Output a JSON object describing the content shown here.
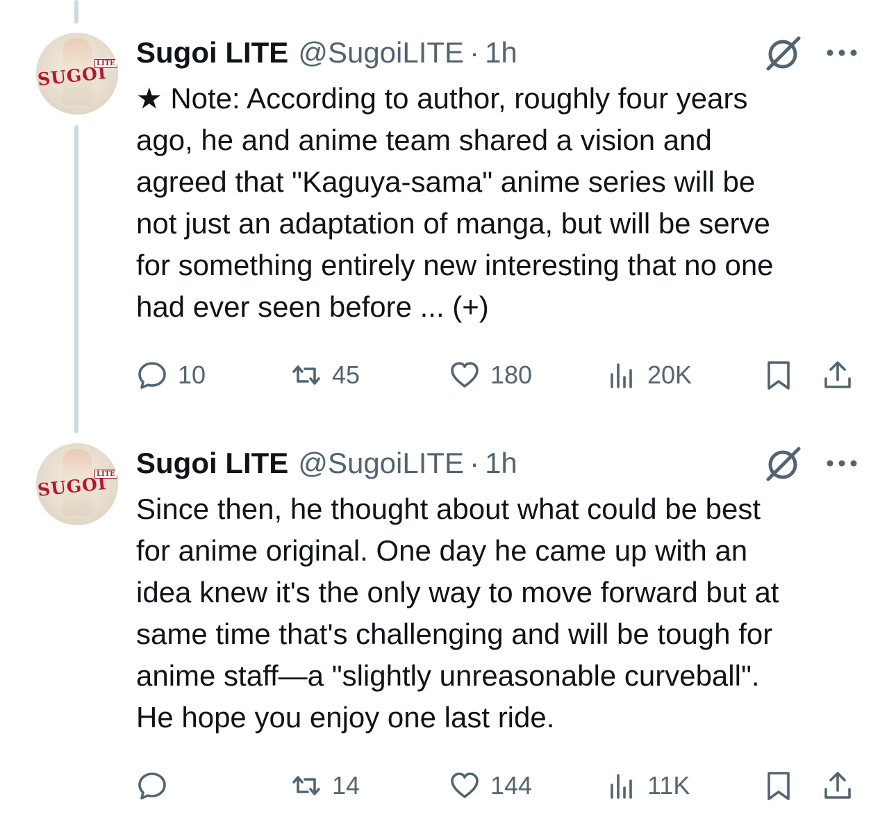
{
  "tweets": [
    {
      "display_name": "Sugoi LITE",
      "handle": "@SugoiLITE",
      "separator": "·",
      "time": "1h",
      "avatar_text": "SUGOI",
      "avatar_tag": "LITE",
      "text": "★ Note: According to author, roughly four years\nago, he and anime team shared a vision and\nagreed that \"Kaguya-sama\" anime series will be\nnot just an adaptation of manga, but will be serve\nfor something entirely new interesting that no one\nhad ever seen before ... (+)",
      "stats": {
        "replies": "10",
        "reposts": "45",
        "likes": "180",
        "views": "20K"
      }
    },
    {
      "display_name": "Sugoi LITE",
      "handle": "@SugoiLITE",
      "separator": "·",
      "time": "1h",
      "avatar_text": "SUGOI",
      "avatar_tag": "LITE",
      "text": "Since then, he thought about what could be best\nfor anime original. One day he came up with an\nidea knew it's the only way to move forward but at\nsame time that's challenging and will be tough for\nanime staff—a \"slightly unreasonable curveball\".\nHe hope you enjoy one last ride.",
      "stats": {
        "replies": "",
        "reposts": "14",
        "likes": "144",
        "views": "11K"
      }
    }
  ],
  "icons": {
    "reply": "reply-icon",
    "repost": "repost-icon",
    "like": "heart-icon",
    "views": "views-chart-icon",
    "bookmark": "bookmark-icon",
    "share": "share-icon",
    "grok": "grok-icon",
    "more": "more-dots-icon"
  },
  "colors": {
    "text": "#0f1419",
    "secondary": "#536471",
    "thread_line": "#cfd9de",
    "avatar_logo": "#b3182b"
  }
}
